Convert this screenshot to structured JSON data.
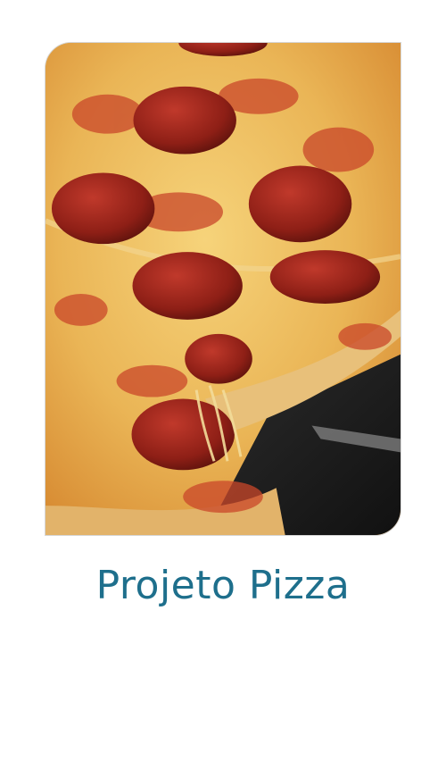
{
  "card": {
    "image_name": "pizza-pepperoni-photo",
    "accent_color": "#1e6f8c"
  },
  "title": "Projeto Pizza"
}
